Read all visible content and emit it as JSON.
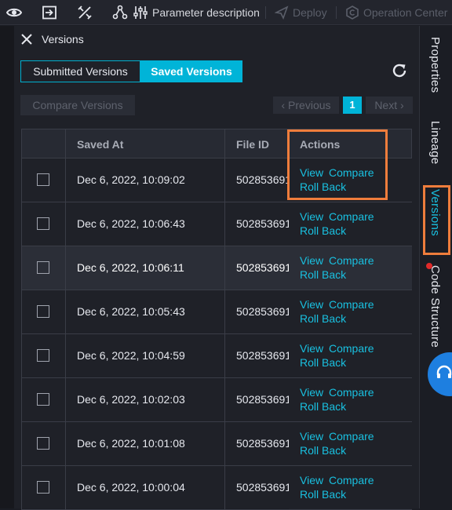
{
  "toolbar": {
    "parameter_label": "Parameter description",
    "deploy_label": "Deploy",
    "operation_center_label": "Operation Center"
  },
  "panel": {
    "title": "Versions",
    "tabs": [
      "Submitted Versions",
      "Saved Versions"
    ],
    "active_tab": "Saved Versions",
    "compare_button": "Compare Versions",
    "pagination": {
      "previous": "Previous",
      "current_page": "1",
      "next": "Next"
    }
  },
  "table": {
    "columns": [
      "Saved At",
      "File ID",
      "Actions"
    ],
    "actions": {
      "view": "View",
      "compare": "Compare",
      "roll_back": "Roll Back"
    },
    "rows": [
      {
        "saved_at": "Dec 6, 2022, 10:09:02",
        "file_id": "502853691"
      },
      {
        "saved_at": "Dec 6, 2022, 10:06:43",
        "file_id": "502853691"
      },
      {
        "saved_at": "Dec 6, 2022, 10:06:11",
        "file_id": "502853691"
      },
      {
        "saved_at": "Dec 6, 2022, 10:05:43",
        "file_id": "502853691"
      },
      {
        "saved_at": "Dec 6, 2022, 10:04:59",
        "file_id": "502853691"
      },
      {
        "saved_at": "Dec 6, 2022, 10:02:03",
        "file_id": "502853691"
      },
      {
        "saved_at": "Dec 6, 2022, 10:01:08",
        "file_id": "502853691"
      },
      {
        "saved_at": "Dec 6, 2022, 10:00:04",
        "file_id": "502853691"
      }
    ]
  },
  "right_rail": {
    "tabs": [
      "Properties",
      "Lineage",
      "Versions",
      "Code Structure"
    ],
    "active_tab": "Versions"
  },
  "colors": {
    "accent": "#00b4d8",
    "highlight_box": "#ef7d3c",
    "background": "#1f2128"
  }
}
